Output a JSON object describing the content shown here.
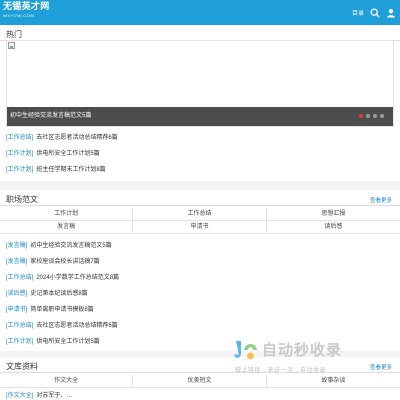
{
  "header": {
    "logo_main": "无锡英才网",
    "logo_sub": "WXYCW.COM",
    "menu_label": "目录"
  },
  "hot": {
    "title": "热门",
    "banner_caption": "初中生经验交流发言稿范文5篇",
    "articles": [
      {
        "tag": "[工作总结]",
        "title": "去社区志愿者活动总结精荐6篇"
      },
      {
        "tag": "[工作计划]",
        "title": "供电所安全工作计划5篇"
      },
      {
        "tag": "[工作计划]",
        "title": "班主任学期末工作计划8篇"
      }
    ]
  },
  "workplace": {
    "title": "职场范文",
    "more": "查看更多",
    "categories": [
      [
        "工作计划",
        "工作总结",
        "思想汇报"
      ],
      [
        "发言稿",
        "申请书",
        "读后感"
      ]
    ],
    "articles": [
      {
        "tag": "[发言稿]",
        "title": "初中生经验交流发言稿范文5篇"
      },
      {
        "tag": "[发言稿]",
        "title": "家校座谈会校长讲话稿7篇"
      },
      {
        "tag": "[工作总结]",
        "title": "2024小学数学工作总结范文8篇"
      },
      {
        "tag": "[读后感]",
        "title": "史记第本纪读后感8篇"
      },
      {
        "tag": "[申请书]",
        "title": "简单离职申请书模板8篇"
      },
      {
        "tag": "[工作总结]",
        "title": "去社区志愿者活动总结精荐6篇"
      },
      {
        "tag": "[工作计划]",
        "title": "供电所安全工作计划5篇"
      }
    ]
  },
  "library": {
    "title": "文库资料",
    "more": "查看更多",
    "categories": [
      [
        "作文大全",
        "优美短文",
        "故事杂谈"
      ]
    ],
    "articles": [
      {
        "tag": "[作文大全]",
        "title": "对苏军于、…"
      }
    ]
  },
  "watermark": {
    "text": "自动秒收录",
    "sub": "做上链接→来访一次→自动收录"
  },
  "colors": {
    "header_bg": "#1e9fd8",
    "link_blue": "#1e88c7",
    "caption_bg": "#4d4d4d",
    "active_dot": "#e23a2e"
  }
}
